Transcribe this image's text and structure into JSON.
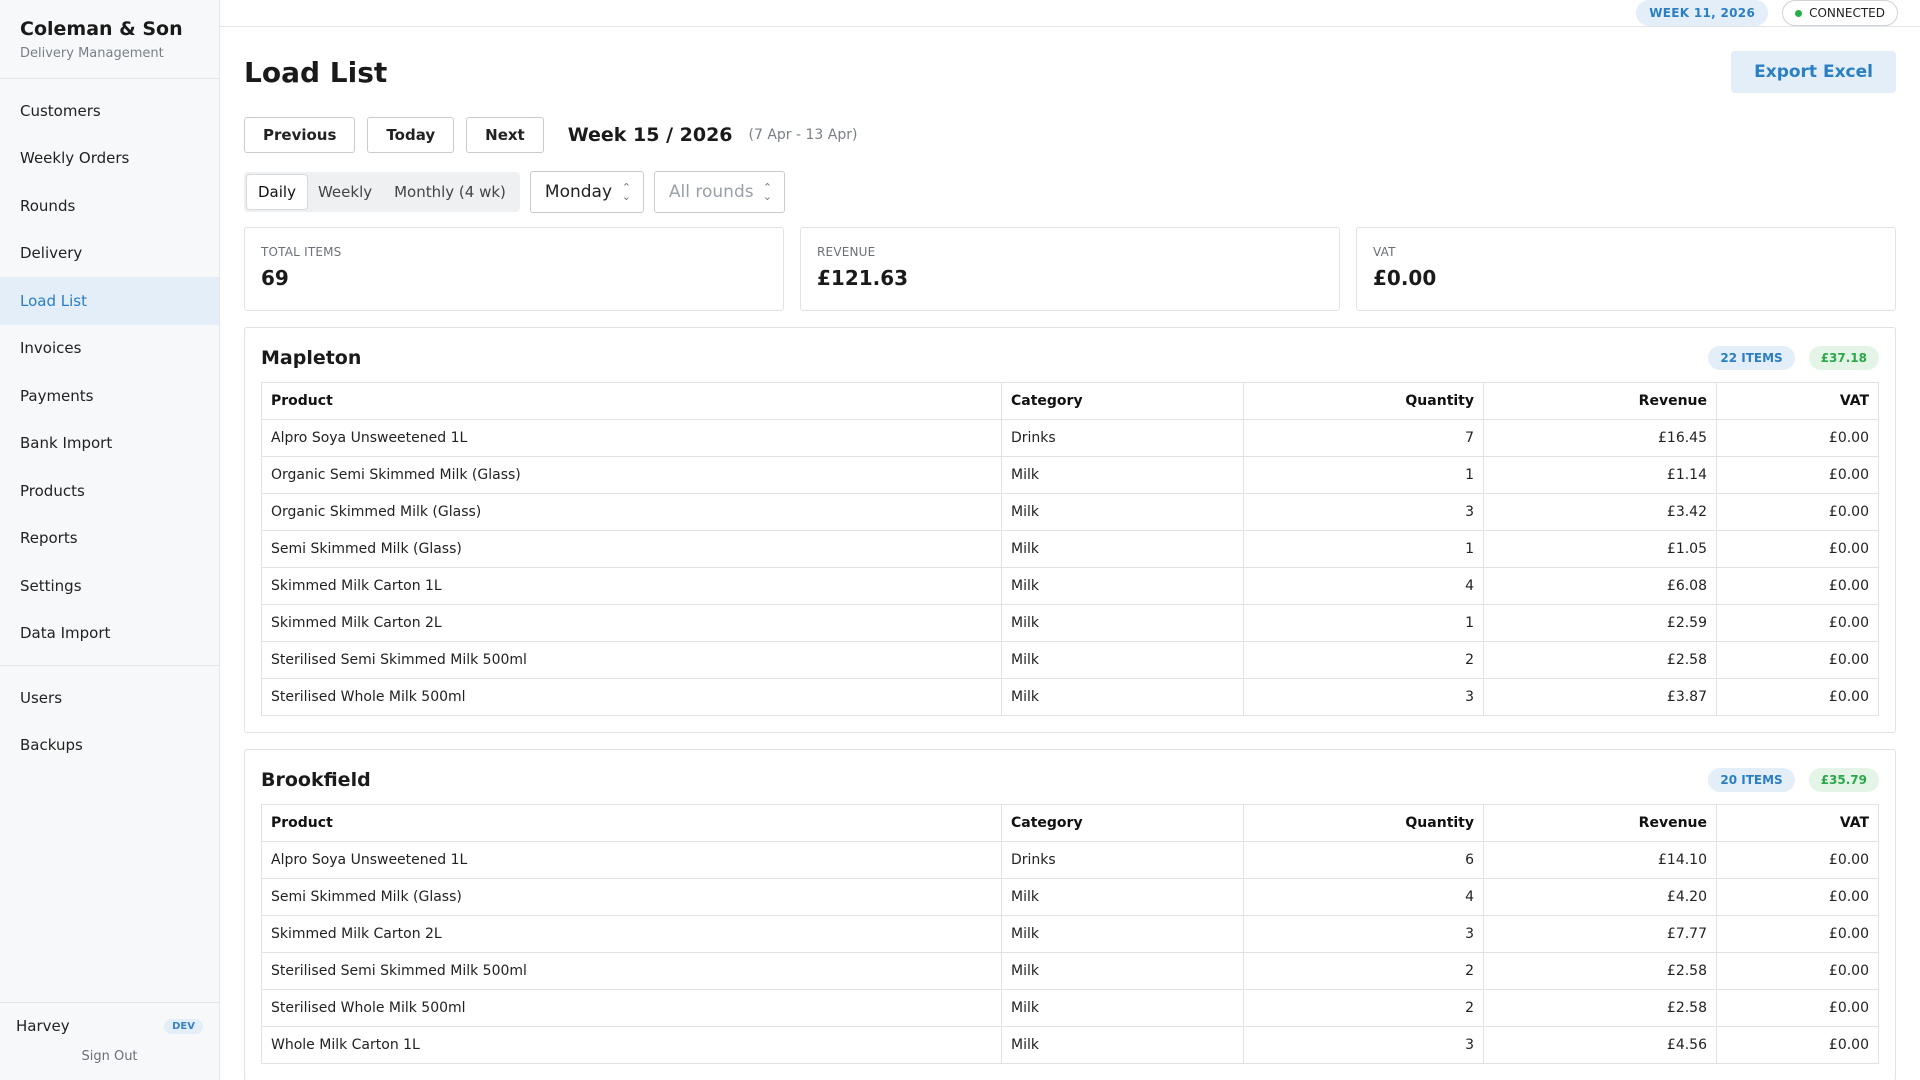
{
  "app": {
    "title": "Coleman & Son",
    "subtitle": "Delivery Management"
  },
  "sidebar": {
    "items": [
      {
        "label": "Customers",
        "active": false
      },
      {
        "label": "Weekly Orders",
        "active": false
      },
      {
        "label": "Rounds",
        "active": false
      },
      {
        "label": "Delivery",
        "active": false
      },
      {
        "label": "Load List",
        "active": true
      },
      {
        "label": "Invoices",
        "active": false
      },
      {
        "label": "Payments",
        "active": false
      },
      {
        "label": "Bank Import",
        "active": false
      },
      {
        "label": "Products",
        "active": false
      },
      {
        "label": "Reports",
        "active": false
      },
      {
        "label": "Settings",
        "active": false
      },
      {
        "label": "Data Import",
        "active": false
      }
    ],
    "admin_items": [
      {
        "label": "Users"
      },
      {
        "label": "Backups"
      }
    ],
    "user": {
      "name": "Harvey",
      "badge": "DEV",
      "sign_out": "Sign Out"
    }
  },
  "topbar": {
    "week_badge": "WEEK 11, 2026",
    "status": "CONNECTED",
    "status_color": "#22b04b"
  },
  "page": {
    "title": "Load List",
    "export_label": "Export Excel",
    "nav": {
      "previous": "Previous",
      "today": "Today",
      "next": "Next"
    },
    "week_label": "Week 15 / 2026",
    "week_range": "(7 Apr - 13 Apr)",
    "modes": [
      {
        "label": "Daily",
        "active": true
      },
      {
        "label": "Weekly",
        "active": false
      },
      {
        "label": "Monthly (4 wk)",
        "active": false
      }
    ],
    "day_select": "Monday",
    "round_select_placeholder": "All rounds"
  },
  "stats": [
    {
      "label": "TOTAL ITEMS",
      "value": "69"
    },
    {
      "label": "REVENUE",
      "value": "£121.63"
    },
    {
      "label": "VAT",
      "value": "£0.00"
    }
  ],
  "table_headers": {
    "product": "Product",
    "category": "Category",
    "quantity": "Quantity",
    "revenue": "Revenue",
    "vat": "VAT"
  },
  "rounds": [
    {
      "name": "Mapleton",
      "items_badge": "22 ITEMS",
      "revenue_badge": "£37.18",
      "rows": [
        {
          "product": "Alpro Soya Unsweetened 1L",
          "category": "Drinks",
          "quantity": "7",
          "revenue": "£16.45",
          "vat": "£0.00"
        },
        {
          "product": "Organic Semi Skimmed Milk (Glass)",
          "category": "Milk",
          "quantity": "1",
          "revenue": "£1.14",
          "vat": "£0.00"
        },
        {
          "product": "Organic Skimmed Milk (Glass)",
          "category": "Milk",
          "quantity": "3",
          "revenue": "£3.42",
          "vat": "£0.00"
        },
        {
          "product": "Semi Skimmed Milk (Glass)",
          "category": "Milk",
          "quantity": "1",
          "revenue": "£1.05",
          "vat": "£0.00"
        },
        {
          "product": "Skimmed Milk Carton 1L",
          "category": "Milk",
          "quantity": "4",
          "revenue": "£6.08",
          "vat": "£0.00"
        },
        {
          "product": "Skimmed Milk Carton 2L",
          "category": "Milk",
          "quantity": "1",
          "revenue": "£2.59",
          "vat": "£0.00"
        },
        {
          "product": "Sterilised Semi Skimmed Milk 500ml",
          "category": "Milk",
          "quantity": "2",
          "revenue": "£2.58",
          "vat": "£0.00"
        },
        {
          "product": "Sterilised Whole Milk 500ml",
          "category": "Milk",
          "quantity": "3",
          "revenue": "£3.87",
          "vat": "£0.00"
        }
      ]
    },
    {
      "name": "Brookfield",
      "items_badge": "20 ITEMS",
      "revenue_badge": "£35.79",
      "rows": [
        {
          "product": "Alpro Soya Unsweetened 1L",
          "category": "Drinks",
          "quantity": "6",
          "revenue": "£14.10",
          "vat": "£0.00"
        },
        {
          "product": "Semi Skimmed Milk (Glass)",
          "category": "Milk",
          "quantity": "4",
          "revenue": "£4.20",
          "vat": "£0.00"
        },
        {
          "product": "Skimmed Milk Carton 2L",
          "category": "Milk",
          "quantity": "3",
          "revenue": "£7.77",
          "vat": "£0.00"
        },
        {
          "product": "Sterilised Semi Skimmed Milk 500ml",
          "category": "Milk",
          "quantity": "2",
          "revenue": "£2.58",
          "vat": "£0.00"
        },
        {
          "product": "Sterilised Whole Milk 500ml",
          "category": "Milk",
          "quantity": "2",
          "revenue": "£2.58",
          "vat": "£0.00"
        },
        {
          "product": "Whole Milk Carton 1L",
          "category": "Milk",
          "quantity": "3",
          "revenue": "£4.56",
          "vat": "£0.00"
        }
      ]
    }
  ]
}
